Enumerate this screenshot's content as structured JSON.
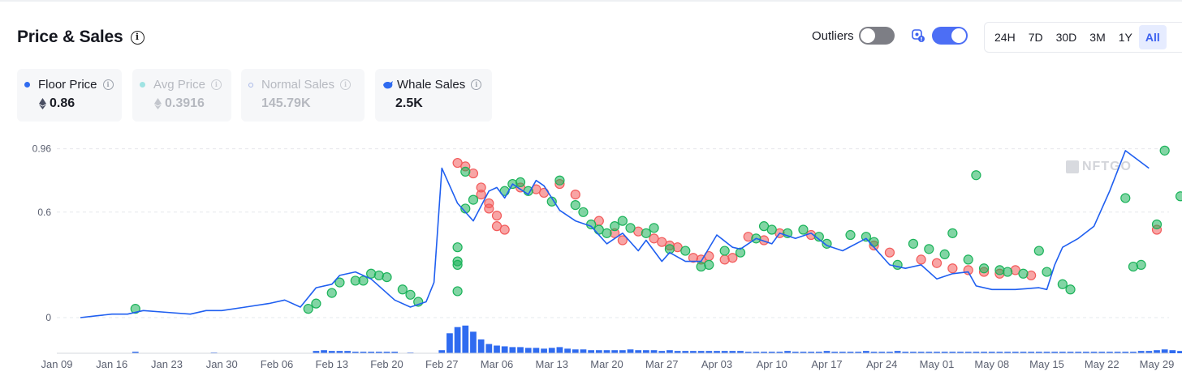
{
  "title": "Price & Sales",
  "controls": {
    "outliers_label": "Outliers",
    "outliers_on": false,
    "whale_toggle_on": true,
    "ranges": [
      "24H",
      "7D",
      "30D",
      "3M",
      "1Y",
      "All"
    ],
    "active_range": "All"
  },
  "cards": {
    "floor": {
      "label": "Floor Price",
      "value": "0.86",
      "color": "#2f6bf0"
    },
    "avg": {
      "label": "Avg Price",
      "value": "0.3916",
      "color": "#9fe3e3"
    },
    "normal": {
      "label": "Normal Sales",
      "value": "145.79K"
    },
    "whale": {
      "label": "Whale Sales",
      "value": "2.5K",
      "color": "#2f6bf0"
    }
  },
  "watermark": "NFTGO",
  "colors": {
    "line": "#1f5ff0",
    "bar": "#2f6bf0",
    "green": "#1bb35a",
    "red": "#f25b5b",
    "grid": "#e6e8ec",
    "tick": "#5b6070"
  },
  "chart_data": {
    "type": "line",
    "y_ticks": [
      "0.96",
      "0.6",
      "0"
    ],
    "ylim": [
      0,
      1.0
    ],
    "x_ticks": [
      "Jan 09",
      "Jan 16",
      "Jan 23",
      "Jan 30",
      "Feb 06",
      "Feb 13",
      "Feb 20",
      "Feb 27",
      "Mar 06",
      "Mar 13",
      "Mar 20",
      "Mar 27",
      "Apr 03",
      "Apr 10",
      "Apr 17",
      "Apr 24",
      "May 01",
      "May 08",
      "May 15",
      "May 22",
      "May 29"
    ],
    "x_start": "Jan 09",
    "x_end": "May 29",
    "floor_price": {
      "day": [
        3,
        5,
        7,
        9,
        11,
        14,
        17,
        19,
        21,
        24,
        27,
        29,
        31,
        33,
        35,
        36,
        38,
        40,
        43,
        45,
        47,
        48,
        49,
        51,
        53,
        55,
        56,
        57,
        58,
        60,
        61,
        62,
        64,
        66,
        68,
        70,
        72,
        74,
        75,
        77,
        78,
        80,
        82,
        84,
        86,
        87,
        89,
        91,
        92,
        94,
        96,
        98,
        100,
        103,
        106,
        108,
        110,
        112,
        114,
        116,
        117,
        119,
        122,
        125,
        126,
        127,
        128,
        130,
        132,
        134,
        136,
        139
      ],
      "value": [
        0.0,
        0.01,
        0.02,
        0.02,
        0.04,
        0.03,
        0.02,
        0.04,
        0.04,
        0.06,
        0.08,
        0.1,
        0.06,
        0.17,
        0.19,
        0.24,
        0.26,
        0.22,
        0.1,
        0.06,
        0.09,
        0.2,
        0.85,
        0.65,
        0.55,
        0.72,
        0.74,
        0.68,
        0.76,
        0.7,
        0.78,
        0.75,
        0.61,
        0.55,
        0.52,
        0.42,
        0.48,
        0.38,
        0.44,
        0.32,
        0.37,
        0.32,
        0.32,
        0.47,
        0.4,
        0.39,
        0.45,
        0.42,
        0.48,
        0.45,
        0.48,
        0.41,
        0.38,
        0.45,
        0.3,
        0.28,
        0.3,
        0.22,
        0.25,
        0.26,
        0.18,
        0.16,
        0.16,
        0.17,
        0.16,
        0.3,
        0.4,
        0.45,
        0.52,
        0.72,
        0.95,
        0.85
      ]
    },
    "whale_sales_green": [
      [
        10,
        0.05
      ],
      [
        32,
        0.05
      ],
      [
        33,
        0.08
      ],
      [
        35,
        0.14
      ],
      [
        36,
        0.2
      ],
      [
        38,
        0.21
      ],
      [
        39,
        0.21
      ],
      [
        40,
        0.25
      ],
      [
        41,
        0.24
      ],
      [
        42,
        0.23
      ],
      [
        44,
        0.16
      ],
      [
        45,
        0.13
      ],
      [
        46,
        0.09
      ],
      [
        51,
        0.15
      ],
      [
        51,
        0.3
      ],
      [
        51,
        0.32
      ],
      [
        51,
        0.4
      ],
      [
        52,
        0.83
      ],
      [
        52,
        0.62
      ],
      [
        53,
        0.67
      ],
      [
        57,
        0.72
      ],
      [
        58,
        0.76
      ],
      [
        59,
        0.77
      ],
      [
        60,
        0.72
      ],
      [
        63,
        0.66
      ],
      [
        64,
        0.78
      ],
      [
        66,
        0.64
      ],
      [
        67,
        0.6
      ],
      [
        68,
        0.53
      ],
      [
        69,
        0.5
      ],
      [
        70,
        0.48
      ],
      [
        71,
        0.52
      ],
      [
        72,
        0.55
      ],
      [
        73,
        0.51
      ],
      [
        75,
        0.48
      ],
      [
        76,
        0.51
      ],
      [
        78,
        0.39
      ],
      [
        80,
        0.38
      ],
      [
        82,
        0.29
      ],
      [
        83,
        0.3
      ],
      [
        85,
        0.38
      ],
      [
        87,
        0.37
      ],
      [
        89,
        0.45
      ],
      [
        90,
        0.52
      ],
      [
        91,
        0.5
      ],
      [
        93,
        0.48
      ],
      [
        95,
        0.5
      ],
      [
        97,
        0.46
      ],
      [
        98,
        0.42
      ],
      [
        101,
        0.47
      ],
      [
        103,
        0.46
      ],
      [
        104,
        0.43
      ],
      [
        107,
        0.3
      ],
      [
        109,
        0.42
      ],
      [
        111,
        0.39
      ],
      [
        113,
        0.36
      ],
      [
        114,
        0.48
      ],
      [
        116,
        0.33
      ],
      [
        117,
        0.81
      ],
      [
        118,
        0.28
      ],
      [
        120,
        0.27
      ],
      [
        121,
        0.26
      ],
      [
        123,
        0.25
      ],
      [
        125,
        0.38
      ],
      [
        126,
        0.26
      ],
      [
        128,
        0.19
      ],
      [
        129,
        0.16
      ],
      [
        136,
        0.68
      ],
      [
        137,
        0.29
      ],
      [
        138,
        0.3
      ],
      [
        140,
        0.53
      ],
      [
        141,
        0.95
      ],
      [
        143,
        0.69
      ]
    ],
    "whale_sales_red": [
      [
        51,
        0.88
      ],
      [
        52,
        0.86
      ],
      [
        53,
        0.82
      ],
      [
        54,
        0.74
      ],
      [
        54,
        0.7
      ],
      [
        55,
        0.65
      ],
      [
        55,
        0.62
      ],
      [
        56,
        0.58
      ],
      [
        56,
        0.52
      ],
      [
        57,
        0.5
      ],
      [
        59,
        0.74
      ],
      [
        61,
        0.73
      ],
      [
        62,
        0.71
      ],
      [
        64,
        0.76
      ],
      [
        66,
        0.7
      ],
      [
        69,
        0.55
      ],
      [
        71,
        0.48
      ],
      [
        72,
        0.44
      ],
      [
        74,
        0.49
      ],
      [
        76,
        0.45
      ],
      [
        77,
        0.43
      ],
      [
        78,
        0.41
      ],
      [
        79,
        0.4
      ],
      [
        81,
        0.34
      ],
      [
        82,
        0.33
      ],
      [
        83,
        0.35
      ],
      [
        85,
        0.33
      ],
      [
        86,
        0.34
      ],
      [
        88,
        0.46
      ],
      [
        90,
        0.44
      ],
      [
        92,
        0.48
      ],
      [
        96,
        0.47
      ],
      [
        104,
        0.41
      ],
      [
        106,
        0.37
      ],
      [
        110,
        0.33
      ],
      [
        112,
        0.31
      ],
      [
        114,
        0.28
      ],
      [
        116,
        0.27
      ],
      [
        118,
        0.26
      ],
      [
        120,
        0.25
      ],
      [
        122,
        0.27
      ],
      [
        124,
        0.24
      ],
      [
        140,
        0.5
      ]
    ],
    "sales_volume": {
      "day": [
        10,
        20,
        33,
        34,
        35,
        36,
        37,
        38,
        39,
        40,
        41,
        42,
        43,
        45,
        49,
        50,
        51,
        52,
        53,
        54,
        55,
        56,
        57,
        58,
        59,
        60,
        61,
        62,
        63,
        64,
        65,
        66,
        67,
        68,
        69,
        70,
        71,
        72,
        73,
        74,
        75,
        76,
        77,
        78,
        79,
        80,
        81,
        82,
        83,
        84,
        85,
        86,
        87,
        88,
        89,
        90,
        91,
        92,
        93,
        94,
        95,
        96,
        97,
        98,
        99,
        100,
        101,
        102,
        103,
        104,
        105,
        106,
        107,
        108,
        109,
        110,
        111,
        112,
        113,
        114,
        115,
        116,
        117,
        118,
        119,
        120,
        121,
        122,
        123,
        124,
        125,
        126,
        127,
        128,
        129,
        130,
        131,
        132,
        133,
        134,
        135,
        136,
        137,
        138,
        139,
        140,
        141,
        142,
        143
      ],
      "value": [
        2,
        1,
        3,
        4,
        3,
        3,
        3,
        2,
        2,
        2,
        2,
        2,
        2,
        1,
        4,
        26,
        34,
        36,
        28,
        18,
        12,
        10,
        9,
        8,
        8,
        7,
        7,
        6,
        7,
        8,
        6,
        5,
        5,
        4,
        4,
        4,
        4,
        4,
        5,
        4,
        4,
        4,
        3,
        4,
        3,
        3,
        3,
        3,
        3,
        3,
        3,
        3,
        3,
        2,
        2,
        2,
        2,
        2,
        3,
        2,
        2,
        2,
        2,
        3,
        2,
        2,
        2,
        2,
        3,
        2,
        2,
        2,
        3,
        2,
        2,
        2,
        2,
        2,
        2,
        2,
        2,
        2,
        2,
        2,
        2,
        2,
        2,
        2,
        2,
        2,
        2,
        2,
        2,
        2,
        2,
        2,
        2,
        2,
        2,
        2,
        2,
        2,
        2,
        3,
        3,
        4,
        5,
        4,
        3
      ]
    },
    "volume_ylim": [
      0,
      40
    ],
    "grid": true
  }
}
